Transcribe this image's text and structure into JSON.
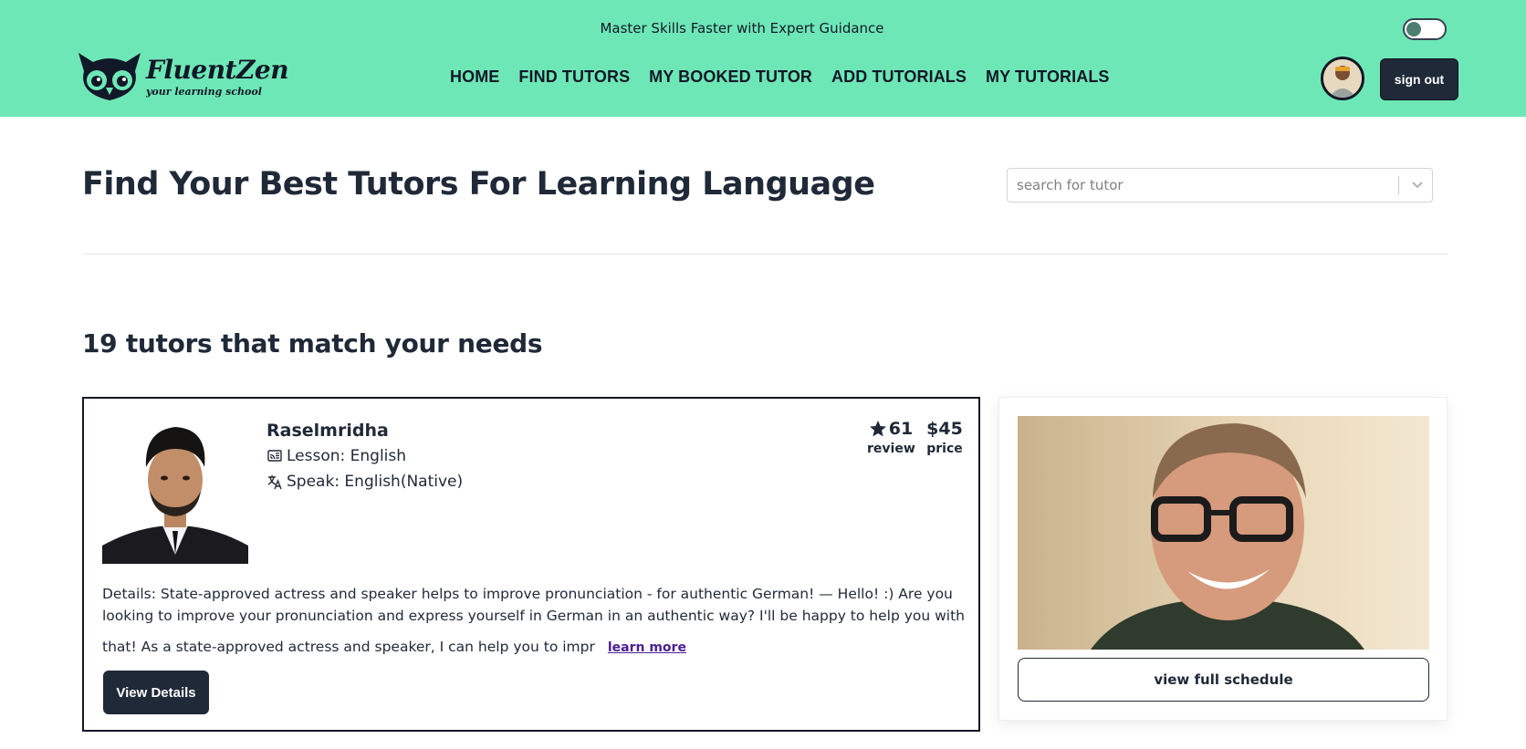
{
  "header": {
    "tagline": "Master Skills Faster with Expert Guidance",
    "brand": {
      "name": "FluentZen",
      "subtitle": "your learning school"
    },
    "nav": [
      {
        "label": "HOME"
      },
      {
        "label": "FIND TUTORS"
      },
      {
        "label": "MY BOOKED TUTOR"
      },
      {
        "label": "ADD TUTORIALS"
      },
      {
        "label": "MY TUTORIALS"
      }
    ],
    "sign_out_label": "sign out",
    "accent_color": "#6ee7b7",
    "theme_toggle": "off"
  },
  "main": {
    "title": "Find Your Best Tutors For Learning Language",
    "search": {
      "placeholder": "search for tutor",
      "value": ""
    },
    "results_heading": "19 tutors that match your needs"
  },
  "tutor_card": {
    "name": "Raselmridha",
    "lesson": "Lesson: English",
    "speak": "Speak: English(Native)",
    "review_value": "61",
    "review_label": "review",
    "price_value": "$45",
    "price_label": "price",
    "details_text": "Details: State-approved actress and speaker helps to improve pronunciation - for authentic German! — Hello! :) Are you looking to improve your pronunciation and express yourself in German in an authentic way? I'll be happy to help you with",
    "details_last": "that! As a state-approved actress and speaker, I can help you to impr",
    "learn_more_label": "learn more",
    "view_details_label": "View Details"
  },
  "side_panel": {
    "schedule_label": "view full schedule"
  }
}
